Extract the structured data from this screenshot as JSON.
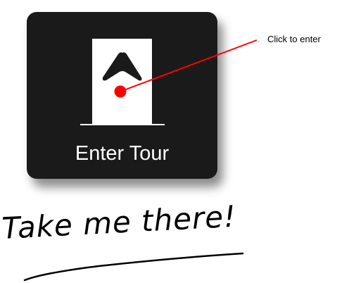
{
  "button": {
    "label": "Enter Tour",
    "icon": "door-arrow-icon"
  },
  "annotation": {
    "callout": "Click to enter",
    "handwriting": "Take me there!"
  },
  "colors": {
    "card": "#1a1a1a",
    "marker": "#ff0000"
  }
}
